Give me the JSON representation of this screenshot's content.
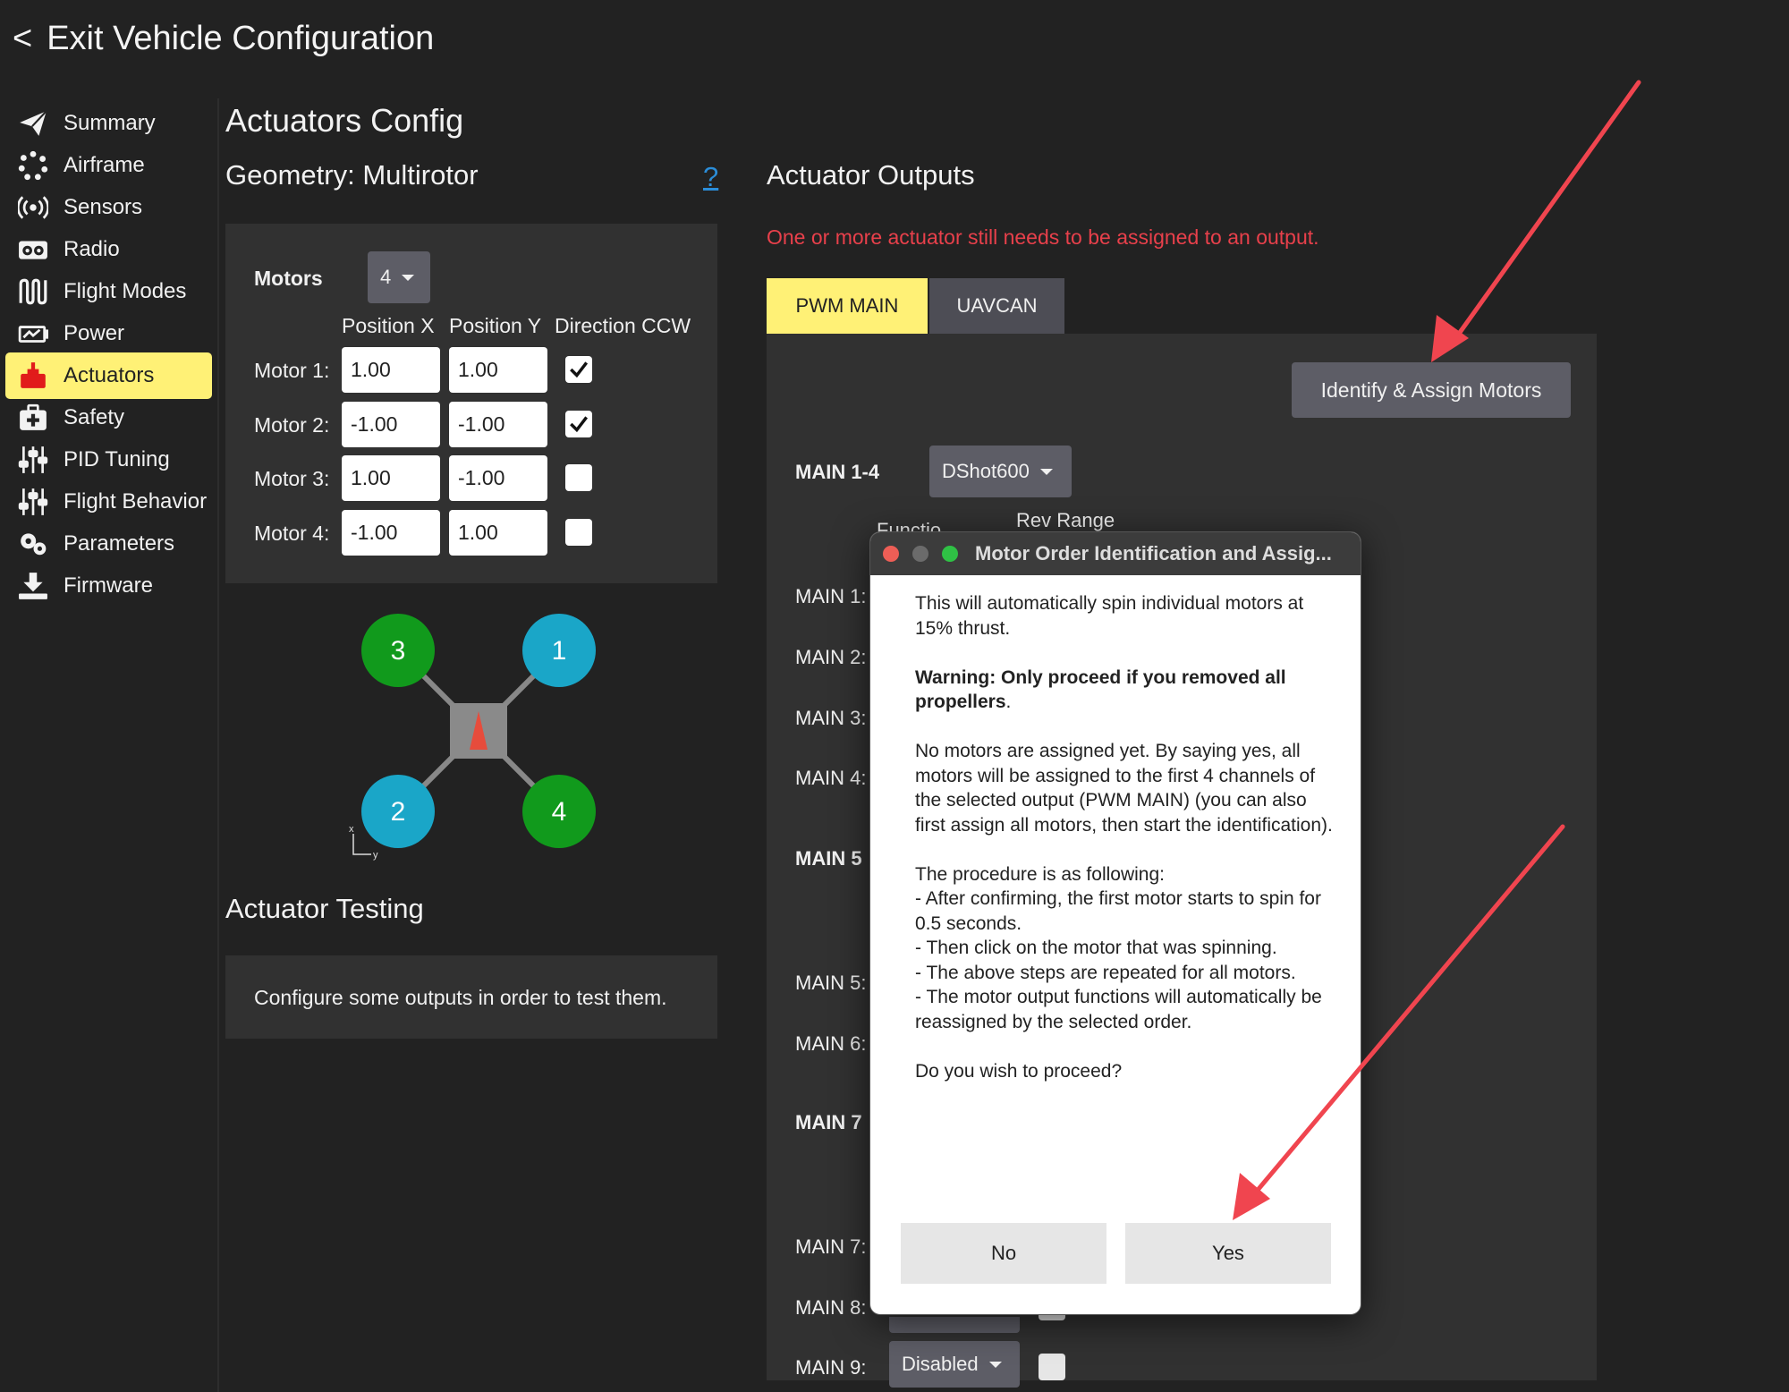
{
  "header": {
    "back_glyph": "<",
    "exit_label": "Exit Vehicle Configuration"
  },
  "sidebar": {
    "active": "Actuators",
    "items": [
      {
        "label": "Summary",
        "icon": "paper-plane-icon"
      },
      {
        "label": "Airframe",
        "icon": "airframe-icon"
      },
      {
        "label": "Sensors",
        "icon": "sensors-icon"
      },
      {
        "label": "Radio",
        "icon": "radio-icon"
      },
      {
        "label": "Flight Modes",
        "icon": "flight-modes-icon"
      },
      {
        "label": "Power",
        "icon": "power-icon"
      },
      {
        "label": "Actuators",
        "icon": "actuators-icon"
      },
      {
        "label": "Safety",
        "icon": "safety-icon"
      },
      {
        "label": "PID Tuning",
        "icon": "sliders-icon"
      },
      {
        "label": "Flight Behavior",
        "icon": "sliders-icon"
      },
      {
        "label": "Parameters",
        "icon": "gears-icon"
      },
      {
        "label": "Firmware",
        "icon": "download-icon"
      }
    ]
  },
  "config": {
    "title": "Actuators Config",
    "geometry_title": "Geometry: Multirotor",
    "help": "?",
    "motors_label": "Motors",
    "motors_count": "4",
    "columns": {
      "pos_x": "Position X",
      "pos_y": "Position Y",
      "ccw": "Direction CCW"
    },
    "motors": [
      {
        "label": "Motor 1:",
        "x": "1.00",
        "y": "1.00",
        "ccw": true
      },
      {
        "label": "Motor 2:",
        "x": "-1.00",
        "y": "-1.00",
        "ccw": true
      },
      {
        "label": "Motor 3:",
        "x": "1.00",
        "y": "-1.00",
        "ccw": false
      },
      {
        "label": "Motor 4:",
        "x": "-1.00",
        "y": "1.00",
        "ccw": false
      }
    ],
    "diagram": {
      "m1": "1",
      "m2": "2",
      "m3": "3",
      "m4": "4",
      "axis_x": "x",
      "axis_y": "y",
      "ccw_color": "#1aa6c8",
      "cw_color": "#119a1c",
      "arrow_color": "#e74c3c"
    }
  },
  "testing": {
    "title": "Actuator Testing",
    "message": "Configure some outputs in order to test them."
  },
  "outputs": {
    "title": "Actuator Outputs",
    "warning": "One or more actuator still needs to be assigned to an output.",
    "warning_color": "#e8404b",
    "tabs": [
      "PWM MAIN",
      "UAVCAN"
    ],
    "identify_button": "Identify & Assign Motors",
    "group_label": "MAIN 1-4",
    "protocol": "DShot600",
    "col_rev_range": "Rev Range",
    "col_function_partial": "Functio",
    "rows": [
      "MAIN 1:",
      "MAIN 2:",
      "MAIN 3:",
      "MAIN 4:",
      "MAIN 5",
      "MAIN 5:",
      "MAIN 6:",
      "MAIN 7",
      "MAIN 7:",
      "MAIN 8:",
      "MAIN 9:"
    ],
    "main9_value": "Disabled"
  },
  "dialog": {
    "title": "Motor Order Identification and Assig...",
    "para1": "This will automatically spin individual motors at 15% thrust.",
    "warning_bold": "Warning: Only proceed if you removed all propellers",
    "warning_tail": ".",
    "para3": "No motors are assigned yet. By saying yes, all motors will be assigned to the first 4 channels of the selected output (PWM MAIN) (you can also first assign all motors, then start the identification).",
    "procedure_lines": [
      "The procedure is as following:",
      "- After confirming, the first motor starts to spin for 0.5 seconds.",
      "- Then click on the motor that was spinning.",
      "- The above steps are repeated for all motors.",
      "- The motor output functions will automatically be reassigned by the selected order."
    ],
    "question": "Do you wish to proceed?",
    "no_label": "No",
    "yes_label": "Yes"
  },
  "annotation": {
    "arrow_color": "#f0454f"
  }
}
